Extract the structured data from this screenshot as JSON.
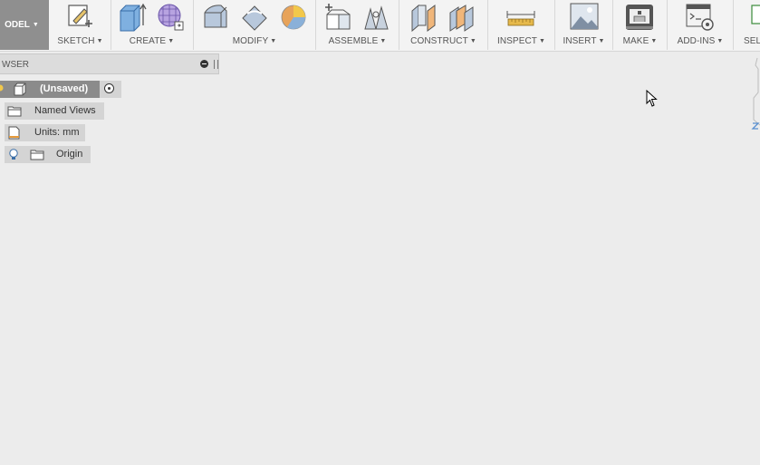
{
  "workspace": {
    "label": "ODEL"
  },
  "toolbar": {
    "groups": [
      {
        "label": "SKETCH"
      },
      {
        "label": "CREATE"
      },
      {
        "label": "MODIFY"
      },
      {
        "label": "ASSEMBLE"
      },
      {
        "label": "CONSTRUCT"
      },
      {
        "label": "INSPECT"
      },
      {
        "label": "INSERT"
      },
      {
        "label": "MAKE"
      },
      {
        "label": "ADD-INS"
      },
      {
        "label": "SEL"
      }
    ]
  },
  "browser": {
    "title": "WSER",
    "nodes": {
      "root": "(Unsaved)",
      "named_views": "Named Views",
      "units": "Units: mm",
      "origin": "Origin"
    }
  },
  "colors": {
    "accent": "#5a8fd0",
    "panel": "#dcdcdc",
    "selected": "#8b8b8b"
  }
}
